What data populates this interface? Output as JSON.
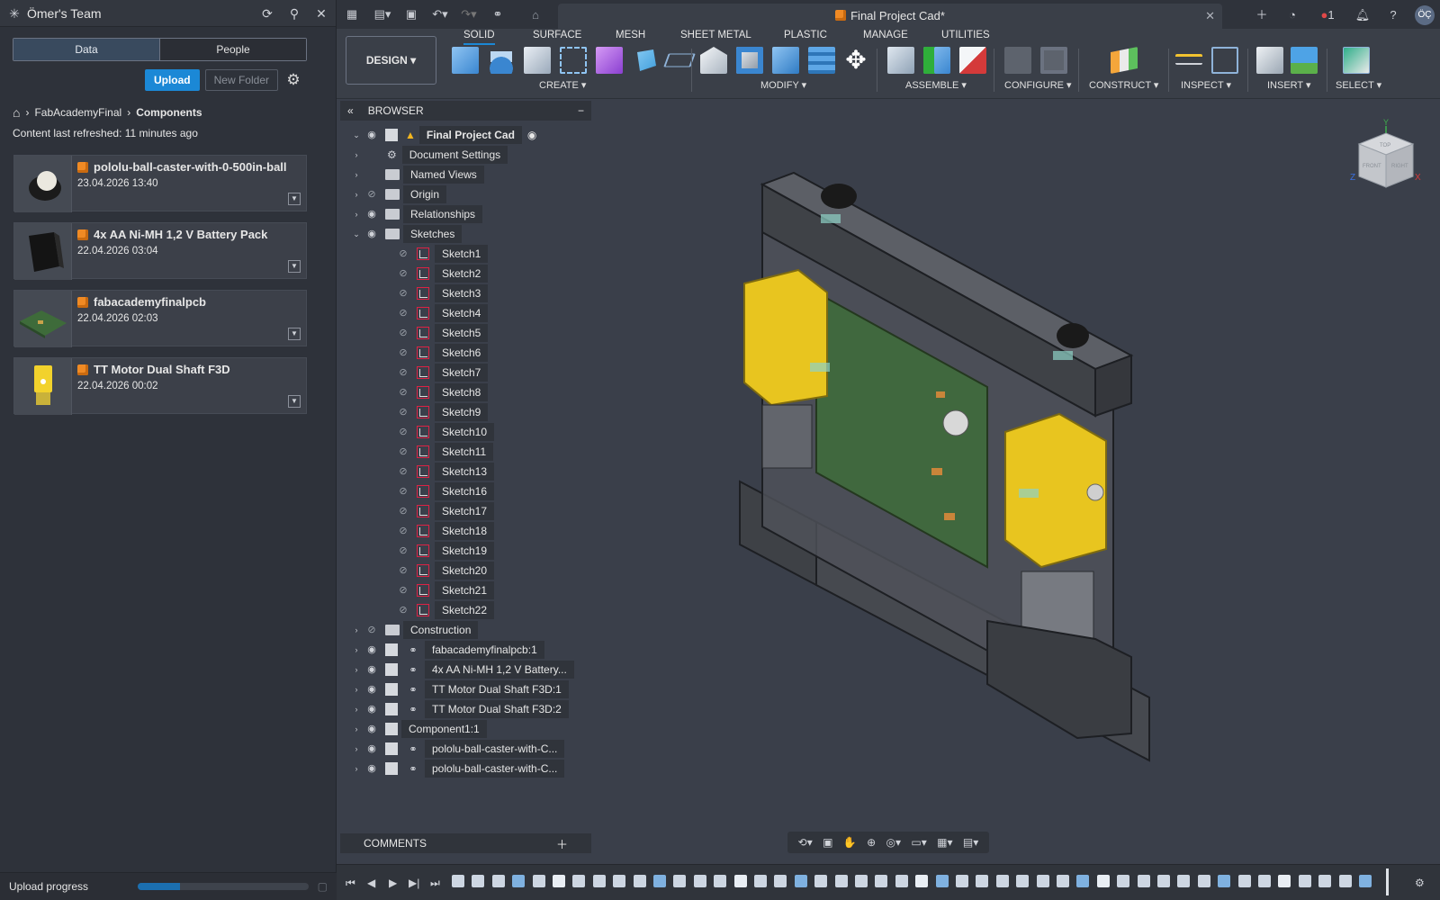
{
  "team": {
    "name": "Ömer's Team"
  },
  "left_tabs": {
    "data": "Data",
    "people": "People"
  },
  "buttons": {
    "upload": "Upload",
    "new_folder": "New Folder"
  },
  "breadcrumb": {
    "root": "FabAcademyFinal",
    "current": "Components"
  },
  "refresh_text": "Content last refreshed: 11 minutes ago",
  "cards": [
    {
      "name": "pololu-ball-caster-with-0-500in-ball",
      "date": "23.04.2026 13:40"
    },
    {
      "name": "4x AA Ni-MH 1,2 V Battery Pack",
      "date": "22.04.2026 03:04"
    },
    {
      "name": "fabacademyfinalpcb",
      "date": "22.04.2026 02:03"
    },
    {
      "name": "TT Motor Dual Shaft F3D",
      "date": "22.04.2026 00:02"
    }
  ],
  "upload_progress": {
    "label": "Upload progress",
    "fraction": 0.25
  },
  "doc_tab": {
    "title": "Final Project Cad*"
  },
  "notifications": {
    "count": "1"
  },
  "user": {
    "initials": "ÖÇ"
  },
  "toolbar": {
    "design": "DESIGN",
    "tabs": [
      "SOLID",
      "SURFACE",
      "MESH",
      "SHEET METAL",
      "PLASTIC",
      "MANAGE",
      "UTILITIES"
    ],
    "groups": [
      "CREATE",
      "MODIFY",
      "ASSEMBLE",
      "CONFIGURE",
      "CONSTRUCT",
      "INSPECT",
      "INSERT",
      "SELECT"
    ]
  },
  "browser": {
    "title": "BROWSER",
    "root": "Final Project Cad",
    "items": [
      "Document Settings",
      "Named Views",
      "Origin",
      "Relationships",
      "Sketches"
    ],
    "sketches": [
      "Sketch1",
      "Sketch2",
      "Sketch3",
      "Sketch4",
      "Sketch5",
      "Sketch6",
      "Sketch7",
      "Sketch8",
      "Sketch9",
      "Sketch10",
      "Sketch11",
      "Sketch13",
      "Sketch16",
      "Sketch17",
      "Sketch18",
      "Sketch19",
      "Sketch20",
      "Sketch21",
      "Sketch22"
    ],
    "after": [
      "Construction",
      "fabacademyfinalpcb:1",
      "4x AA Ni-MH 1,2 V Battery...",
      "TT Motor Dual Shaft F3D:1",
      "TT Motor Dual Shaft F3D:2",
      "Component1:1",
      "pololu-ball-caster-with-C...",
      "pololu-ball-caster-with-C..."
    ]
  },
  "comments": {
    "title": "COMMENTS"
  },
  "viewcube": {
    "top": "TOP",
    "front": "FRONT",
    "right": "RIGHT",
    "z": "Z",
    "x": "X",
    "y": "Y"
  },
  "colors": {
    "accent": "#1b88d6",
    "motor": "#e8c51f",
    "pcb": "#3f6b3c",
    "body": "#4a4d52"
  }
}
